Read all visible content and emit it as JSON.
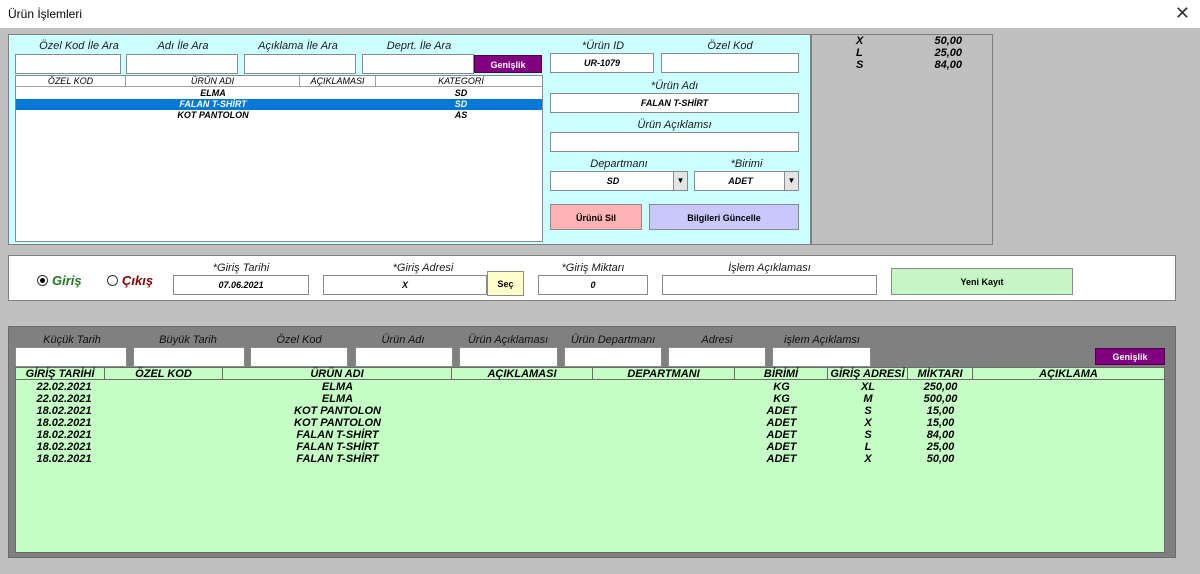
{
  "window": {
    "title": "Ürün İşlemleri"
  },
  "search": {
    "labels": [
      "Özel Kod İle Ara",
      "Adı İle Ara",
      "Açıklama İle Ara",
      "Deprt. İle Ara"
    ],
    "expand_label": "Genişlik"
  },
  "product_list": {
    "headers": [
      "ÖZEL KOD",
      "ÜRÜN ADI",
      "AÇIKLAMASI",
      "KATEGORİ"
    ],
    "rows": [
      {
        "code": "",
        "name": "ELMA",
        "desc": "",
        "cat": "SD"
      },
      {
        "code": "",
        "name": "FALAN T-SHİRT",
        "desc": "",
        "cat": "SD"
      },
      {
        "code": "",
        "name": "KOT PANTOLON",
        "desc": "",
        "cat": "AS"
      }
    ]
  },
  "form": {
    "id_label": "*Ürün ID",
    "id_value": "UR-1079",
    "code_label": "Özel Kod",
    "code_value": "",
    "name_label": "*Ürün Adı",
    "name_value": "FALAN T-SHİRT",
    "desc_label": "Ürün Açıklamsı",
    "desc_value": "",
    "dept_label": "Departmanı",
    "dept_value": "SD",
    "unit_label": "*Birimi",
    "unit_value": "ADET",
    "delete_label": "Ürünü Sil",
    "update_label": "Bilgileri Güncelle"
  },
  "stock_summary": [
    {
      "size": "X",
      "qty": "50,00"
    },
    {
      "size": "L",
      "qty": "25,00"
    },
    {
      "size": "S",
      "qty": "84,00"
    }
  ],
  "entry": {
    "radio_in": "Giriş",
    "radio_out": "Çıkış",
    "date_label": "*Giriş Tarihi",
    "date_value": "07.06.2021",
    "addr_label": "*Giriş Adresi",
    "addr_value": "X",
    "select_label": "Seç",
    "qty_label": "*Giriş Miktarı",
    "qty_value": "0",
    "note_label": "İşlem Açıklaması",
    "note_value": "",
    "new_label": "Yeni Kayıt"
  },
  "filters": {
    "labels": [
      "Küçük Tarih",
      "Büyük Tarih",
      "Özel Kod",
      "Ürün Adı",
      "Ürün Açıklaması",
      "Ürün Departmanı",
      "Adresi",
      "işlem Açıklamsı"
    ],
    "expand_label": "Genişlik"
  },
  "movements": {
    "headers": [
      "GİRİŞ TARİHİ",
      "ÖZEL KOD",
      "ÜRÜN ADI",
      "AÇIKLAMASI",
      "DEPARTMANI",
      "BİRİMİ",
      "GİRİŞ ADRESİ",
      "MİKTARI",
      "AÇIKLAMA"
    ],
    "rows": [
      [
        "22.02.2021",
        "",
        "ELMA",
        "",
        "",
        "KG",
        "XL",
        "250,00",
        ""
      ],
      [
        "22.02.2021",
        "",
        "ELMA",
        "",
        "",
        "KG",
        "M",
        "500,00",
        ""
      ],
      [
        "18.02.2021",
        "",
        "KOT PANTOLON",
        "",
        "",
        "ADET",
        "S",
        "15,00",
        ""
      ],
      [
        "18.02.2021",
        "",
        "KOT PANTOLON",
        "",
        "",
        "ADET",
        "X",
        "15,00",
        ""
      ],
      [
        "18.02.2021",
        "",
        "FALAN T-SHİRT",
        "",
        "",
        "ADET",
        "S",
        "84,00",
        ""
      ],
      [
        "18.02.2021",
        "",
        "FALAN T-SHİRT",
        "",
        "",
        "ADET",
        "L",
        "25,00",
        ""
      ],
      [
        "18.02.2021",
        "",
        "FALAN T-SHİRT",
        "",
        "",
        "ADET",
        "X",
        "50,00",
        ""
      ]
    ]
  }
}
